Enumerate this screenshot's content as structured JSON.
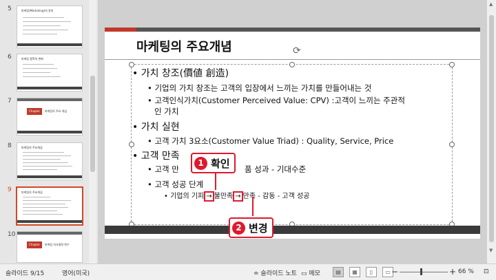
{
  "thumbnails": [
    {
      "num": "5",
      "title": "마케팅(Marketing)의 정의",
      "style": "text"
    },
    {
      "num": "6",
      "title": "마케팅 철학의 변화",
      "style": "text"
    },
    {
      "num": "7",
      "title": "마케팅의 주요 개념",
      "chapter": "Chapter",
      "style": "chapter"
    },
    {
      "num": "8",
      "title": "마케팅의 주요개념",
      "style": "text"
    },
    {
      "num": "9",
      "title": "마케팅의 주요개념",
      "style": "text",
      "active": true
    },
    {
      "num": "10",
      "title": "마케팅 의사결정 변수",
      "chapter": "Chapter",
      "style": "chapter"
    }
  ],
  "slide": {
    "title": "마케팅의 주요개념",
    "b1_value": "• 가치 창조(價値 創造)",
    "b1_value_s1": "• 기업의 가치 창조는 고객의 입장에서 느끼는 가치를 만들어내는 것",
    "b1_value_s2a": "• 고객인식가치(Customer Perceived Value: CPV) :고객이 느끼는 주관적",
    "b1_value_s2b": "인 가치",
    "b1_real": "• 가치 실현",
    "b1_real_s1": "• 고객 가치 3요소(Customer Value Triad) : Quality, Service, Price",
    "b1_sat": "• 고객 만족",
    "b1_sat_s1a": "• 고객 만",
    "b1_sat_s1b": "품 성과 - 기대수준",
    "b1_sat_s2": "• 고객 성공 단계",
    "b3_a": "• 기업의 기피",
    "arrow1": "→",
    "b3_b": "불만족",
    "arrow2": "→",
    "b3_c": "만족 - 감동 - 고객 성공"
  },
  "callouts": {
    "one_num": "1",
    "one_label": "확인",
    "two_num": "2",
    "two_label": "변경"
  },
  "status": {
    "slide_info": "슬라이드 9/15",
    "language": "영어(미국)",
    "notes": "슬라이드 노트",
    "comments": "메모",
    "zoom": "66 %"
  },
  "colors": {
    "accent": "#e0182d",
    "brand": "#d24726"
  }
}
